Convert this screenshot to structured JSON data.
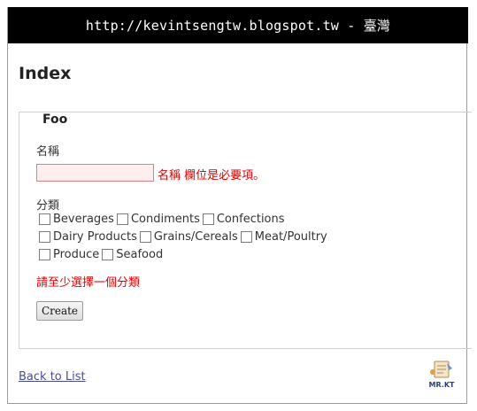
{
  "banner": {
    "text": "http://kevintsengtw.blogspot.tw - 臺灣"
  },
  "page": {
    "title": "Index"
  },
  "form": {
    "legend": "Foo",
    "name_label": "名稱",
    "name_value": "",
    "name_error": "名稱 欄位是必要項。",
    "category_label": "分類",
    "categories": [
      {
        "label": "Beverages",
        "checked": false
      },
      {
        "label": "Condiments",
        "checked": false
      },
      {
        "label": "Confections",
        "checked": false
      },
      {
        "label": "Dairy Products",
        "checked": false
      },
      {
        "label": "Grains/Cereals",
        "checked": false
      },
      {
        "label": "Meat/Poultry",
        "checked": false
      },
      {
        "label": "Produce",
        "checked": false
      },
      {
        "label": "Seafood",
        "checked": false
      }
    ],
    "category_error": "請至少選擇一個分類",
    "create_label": "Create"
  },
  "footer": {
    "back_link": "Back to List",
    "logo_text": "MR.KT",
    "logo_icon": "mrkt-logo-icon"
  },
  "colors": {
    "error": "#e00000",
    "input_error_bg": "#ffeeee",
    "input_error_border": "#e08080",
    "link": "#4a4a9a",
    "banner_bg": "#000000"
  }
}
